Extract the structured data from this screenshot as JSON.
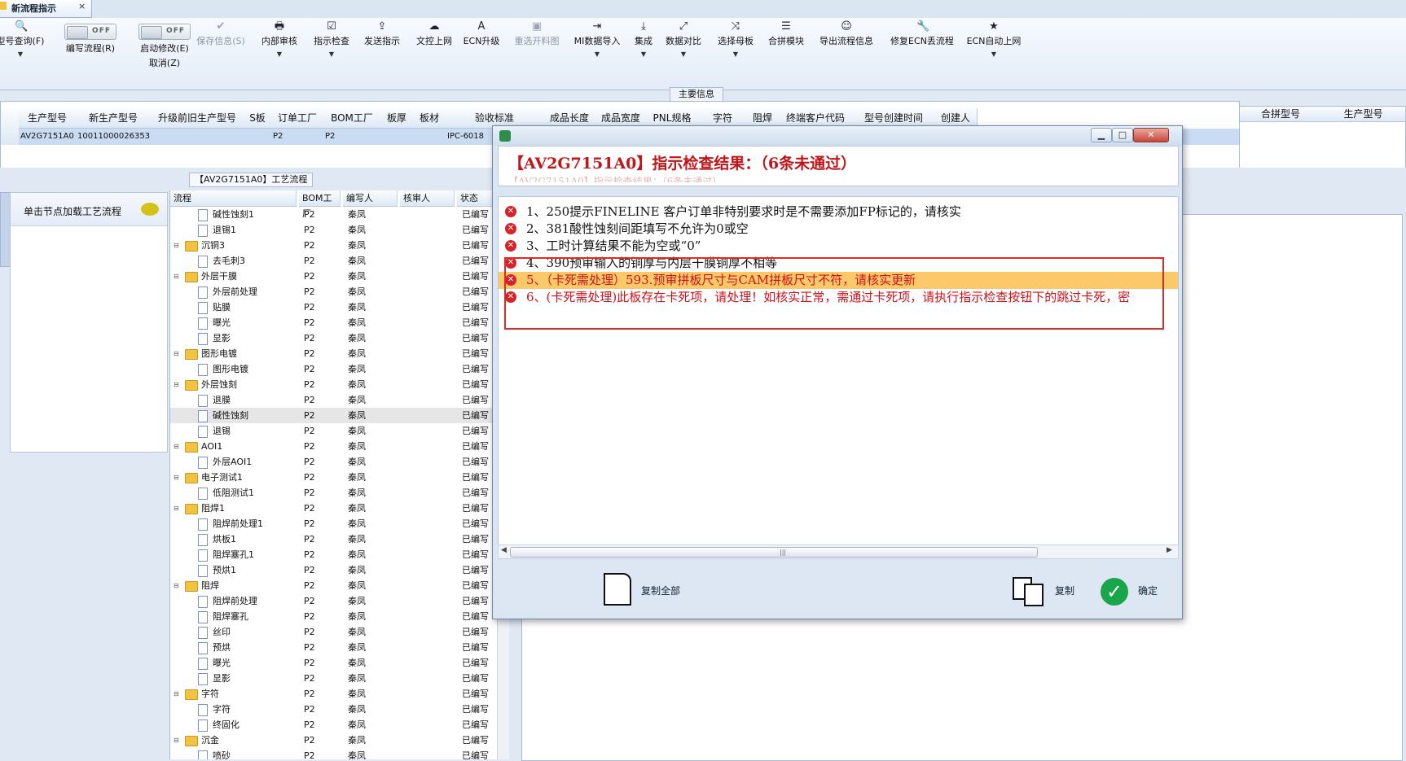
{
  "tab": {
    "title": "新流程指示",
    "close": "×"
  },
  "ribbon": {
    "buttons": [
      {
        "label": "型号查询(F)",
        "icon": "search-icon",
        "glyph": "🔍"
      },
      {
        "label": "保存信息(S)",
        "icon": "check-icon",
        "glyph": "✔"
      },
      {
        "label": "内部审核",
        "icon": "printer-icon",
        "glyph": "🖶"
      },
      {
        "label": "指示检查",
        "icon": "checklist-icon",
        "glyph": "☑"
      },
      {
        "label": "发送指示",
        "icon": "upload-icon",
        "glyph": "⇪"
      },
      {
        "label": "文控上网",
        "icon": "cloud-upload-icon",
        "glyph": "☁"
      },
      {
        "label": "ECN升级",
        "icon": "font-icon",
        "glyph": "A"
      },
      {
        "label": "重选开料图",
        "icon": "image-icon",
        "glyph": "▣"
      },
      {
        "label": "MI数据导入",
        "icon": "import-icon",
        "glyph": "⇥"
      },
      {
        "label": "集成",
        "icon": "download-icon",
        "glyph": "⤓"
      },
      {
        "label": "数据对比",
        "icon": "compare-icon",
        "glyph": "⤢"
      },
      {
        "label": "选择母板",
        "icon": "shuffle-icon",
        "glyph": "⤨"
      },
      {
        "label": "合拼模块",
        "icon": "list-icon",
        "glyph": "☰"
      },
      {
        "label": "导出流程信息",
        "icon": "smile-icon",
        "glyph": "☺"
      },
      {
        "label": "修复ECN丢流程",
        "icon": "wrench-icon",
        "glyph": "🔧"
      },
      {
        "label": "ECN自动上网",
        "icon": "star-icon",
        "glyph": "★"
      }
    ],
    "toggles": [
      {
        "label": "编写流程(R)",
        "state": "OFF"
      },
      {
        "label": "启动修改(E)",
        "sublabel": "取消(Z)",
        "state": "OFF"
      }
    ],
    "group_label": "主要信息"
  },
  "main_grid": {
    "columns": [
      "生产型号",
      "新生产型号",
      "升级前旧生产型号",
      "S板",
      "订单工厂",
      "BOM工厂",
      "板厚",
      "板材",
      "验收标准",
      "成品长度",
      "成品宽度",
      "PNL规格",
      "字符",
      "阻焊",
      "终端客户代码",
      "型号创建时间",
      "创建人"
    ],
    "row": {
      "生产型号": "AV2G7151A0",
      "新生产型号": "10011000026353",
      "订单工厂": "P2",
      "BOM工厂": "P2",
      "验收标准": "IPC-6018"
    },
    "right_columns": [
      "合拼型号",
      "生产型号"
    ]
  },
  "process": {
    "title": "【AV2G7151A0】工艺流程",
    "hint": "单击节点加载工艺流程",
    "columns": [
      "流程",
      "BOM工厂",
      "编写人",
      "核审人",
      "状态"
    ],
    "rows": [
      {
        "name": "碱性蚀刻1",
        "level": 2,
        "factory": "P2",
        "writer": "秦凤",
        "status": "已编写"
      },
      {
        "name": "退锡1",
        "level": 2,
        "factory": "P2",
        "writer": "秦凤",
        "status": "已编写"
      },
      {
        "name": "沉铜3",
        "level": 1,
        "factory": "P2",
        "writer": "秦凤",
        "status": "已编写"
      },
      {
        "name": "去毛刺3",
        "level": 2,
        "factory": "P2",
        "writer": "秦凤",
        "status": "已编写"
      },
      {
        "name": "外层干膜",
        "level": 1,
        "factory": "P2",
        "writer": "秦凤",
        "status": "已编写"
      },
      {
        "name": "外层前处理",
        "level": 2,
        "factory": "P2",
        "writer": "秦凤",
        "status": "已编写"
      },
      {
        "name": "贴膜",
        "level": 2,
        "factory": "P2",
        "writer": "秦凤",
        "status": "已编写"
      },
      {
        "name": "曝光",
        "level": 2,
        "factory": "P2",
        "writer": "秦凤",
        "status": "已编写"
      },
      {
        "name": "显影",
        "level": 2,
        "factory": "P2",
        "writer": "秦凤",
        "status": "已编写"
      },
      {
        "name": "图形电镀",
        "level": 1,
        "factory": "P2",
        "writer": "秦凤",
        "status": "已编写"
      },
      {
        "name": "图形电镀",
        "level": 2,
        "factory": "P2",
        "writer": "秦凤",
        "status": "已编写"
      },
      {
        "name": "外层蚀刻",
        "level": 1,
        "factory": "P2",
        "writer": "秦凤",
        "status": "已编写"
      },
      {
        "name": "退膜",
        "level": 2,
        "factory": "P2",
        "writer": "秦凤",
        "status": "已编写"
      },
      {
        "name": "碱性蚀刻",
        "level": 2,
        "factory": "P2",
        "writer": "秦凤",
        "status": "已编写",
        "selected": true
      },
      {
        "name": "退锡",
        "level": 2,
        "factory": "P2",
        "writer": "秦凤",
        "status": "已编写"
      },
      {
        "name": "AOI1",
        "level": 1,
        "factory": "P2",
        "writer": "秦凤",
        "status": "已编写"
      },
      {
        "name": "外层AOI1",
        "level": 2,
        "factory": "P2",
        "writer": "秦凤",
        "status": "已编写"
      },
      {
        "name": "电子测试1",
        "level": 1,
        "factory": "P2",
        "writer": "秦凤",
        "status": "已编写"
      },
      {
        "name": "低阻测试1",
        "level": 2,
        "factory": "P2",
        "writer": "秦凤",
        "status": "已编写"
      },
      {
        "name": "阻焊1",
        "level": 1,
        "factory": "P2",
        "writer": "秦凤",
        "status": "已编写"
      },
      {
        "name": "阻焊前处理1",
        "level": 2,
        "factory": "P2",
        "writer": "秦凤",
        "status": "已编写"
      },
      {
        "name": "烘板1",
        "level": 2,
        "factory": "P2",
        "writer": "秦凤",
        "status": "已编写"
      },
      {
        "name": "阻焊塞孔1",
        "level": 2,
        "factory": "P2",
        "writer": "秦凤",
        "status": "已编写"
      },
      {
        "name": "预烘1",
        "level": 2,
        "factory": "P2",
        "writer": "秦凤",
        "status": "已编写"
      },
      {
        "name": "阻焊",
        "level": 1,
        "factory": "P2",
        "writer": "秦凤",
        "status": "已编写"
      },
      {
        "name": "阻焊前处理",
        "level": 2,
        "factory": "P2",
        "writer": "秦凤",
        "status": "已编写"
      },
      {
        "name": "阻焊塞孔",
        "level": 2,
        "factory": "P2",
        "writer": "秦凤",
        "status": "已编写"
      },
      {
        "name": "丝印",
        "level": 2,
        "factory": "P2",
        "writer": "秦凤",
        "status": "已编写"
      },
      {
        "name": "预烘",
        "level": 2,
        "factory": "P2",
        "writer": "秦凤",
        "status": "已编写"
      },
      {
        "name": "曝光",
        "level": 2,
        "factory": "P2",
        "writer": "秦凤",
        "status": "已编写"
      },
      {
        "name": "显影",
        "level": 2,
        "factory": "P2",
        "writer": "秦凤",
        "status": "已编写"
      },
      {
        "name": "字符",
        "level": 1,
        "factory": "P2",
        "writer": "秦凤",
        "status": "已编写"
      },
      {
        "name": "字符",
        "level": 2,
        "factory": "P2",
        "writer": "秦凤",
        "status": "已编写"
      },
      {
        "name": "终固化",
        "level": 2,
        "factory": "P2",
        "writer": "秦凤",
        "status": "已编写"
      },
      {
        "name": "沉金",
        "level": 1,
        "factory": "P2",
        "writer": "秦凤",
        "status": "已编写"
      },
      {
        "name": "喷砂",
        "level": 2,
        "factory": "P2",
        "writer": "秦凤",
        "status": "已编写"
      }
    ]
  },
  "dialog": {
    "title": "【AV2G7151A0】指示检查结果：（6条未通过）",
    "ghost_title": "【AV2G7151A0】指示检查结果：（6条未通过）",
    "messages": [
      {
        "text": "1、250提示FINELINE 客户订单非特别要求时是不需要添加FP标记的，请核实",
        "style": "normal"
      },
      {
        "text": "2、381酸性蚀刻间距填写不允许为0或空",
        "style": "normal"
      },
      {
        "text": "3、工时计算结果不能为空或“0”",
        "style": "normal"
      },
      {
        "text": "4、390预审输入的铜厚与内层干膜铜厚不相等",
        "style": "normal"
      },
      {
        "text": "5、（卡死需处理）593.预审拼板尺寸与CAM拼板尺寸不符，请核实更新",
        "style": "highlight"
      },
      {
        "text": "6、(卡死需处理)此板存在卡死项，请处理！如核实正常，需通过卡死项，请执行指示检查按钮下的跳过卡死，密",
        "style": "red"
      }
    ],
    "buttons": {
      "copy_all": "复制全部",
      "copy": "复制",
      "ok": "确定"
    },
    "colors": {
      "title": "#c2151a",
      "error": "#d8222a",
      "highlight": "#fbc96a",
      "annotation": "#e02a2a",
      "ok": "#19a64a"
    }
  }
}
